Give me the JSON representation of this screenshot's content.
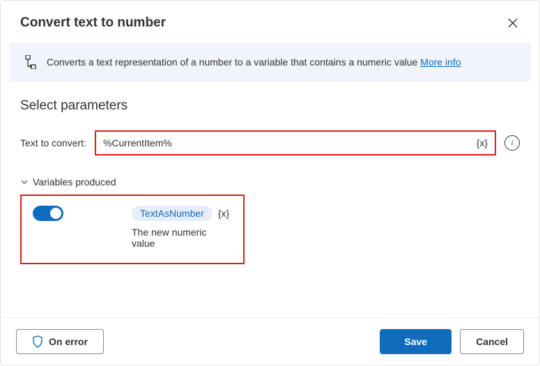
{
  "header": {
    "title": "Convert text to number"
  },
  "banner": {
    "text": "Converts a text representation of a number to a variable that contains a numeric value ",
    "more_info": "More info"
  },
  "section": {
    "title": "Select parameters"
  },
  "field": {
    "label": "Text to convert:",
    "value": "%CurrentItem%",
    "var_token": "{x}"
  },
  "vars": {
    "heading": "Variables produced",
    "name": "TextAsNumber",
    "token": "{x}",
    "desc": "The new numeric value"
  },
  "footer": {
    "on_error": "On error",
    "save": "Save",
    "cancel": "Cancel"
  }
}
